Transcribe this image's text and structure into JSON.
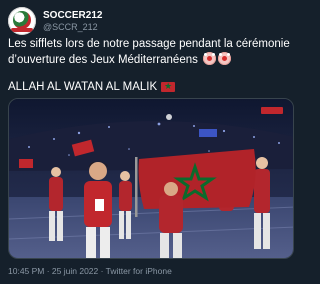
{
  "author": {
    "display_name": "SOCCER212",
    "handle": "@SCCR_212",
    "avatar_icon": "soccer-club-logo-icon"
  },
  "tweet": {
    "line1": "Les sifflets lors de notre passage pendant la cérémonie",
    "line2": "d’ouverture des Jeux Méditerranéens",
    "line2_emojis": [
      "clown-face-icon",
      "clown-face-icon"
    ],
    "slogan": "ALLAH AL WATAN AL MALIK",
    "slogan_emoji": "morocco-flag-icon"
  },
  "media": {
    "type": "photo",
    "flag_colors": {
      "red": "#c1272d",
      "star": "#0a6b2c"
    }
  },
  "footer": {
    "timestamp": "10:45 PM · 25 juin 2022 · Twitter for iPhone"
  },
  "colors": {
    "background": "#15202b",
    "secondary_text": "#8b98a5",
    "primary_text": "#ffffff"
  }
}
